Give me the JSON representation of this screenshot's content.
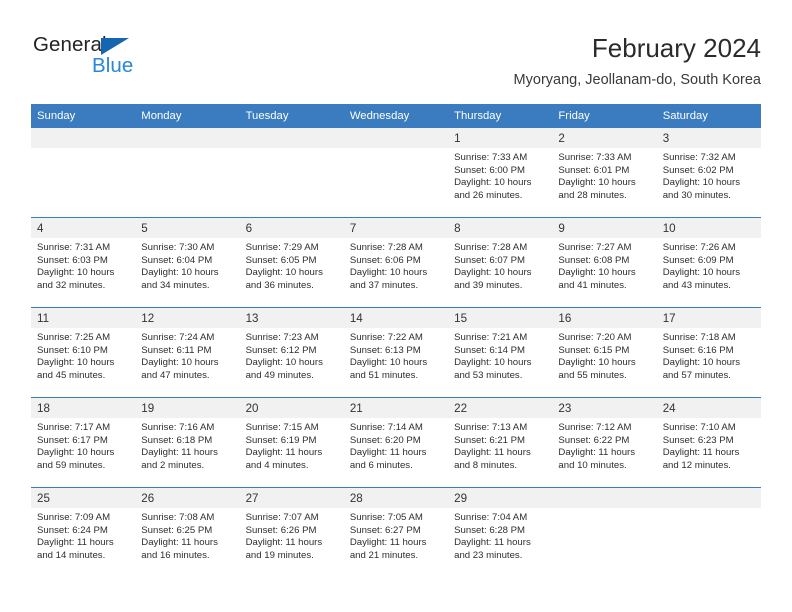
{
  "brand": {
    "line1": "General",
    "line2": "Blue",
    "triangle_color": "#1565b0",
    "line1_color": "#242424",
    "line2_color": "#2a86d8"
  },
  "header": {
    "title": "February 2024",
    "subtitle": "Myoryang, Jeollanam-do, South Korea"
  },
  "colors": {
    "header_row_bg": "#3a7cbf",
    "header_row_text": "#ffffff",
    "daynum_bg": "#f1f1f1",
    "cell_text": "#2e2e2e"
  },
  "weekdays": [
    "Sunday",
    "Monday",
    "Tuesday",
    "Wednesday",
    "Thursday",
    "Friday",
    "Saturday"
  ],
  "weeks": [
    [
      {
        "day": "",
        "sunrise": "",
        "sunset": "",
        "daylight_line1": "",
        "daylight_line2": ""
      },
      {
        "day": "",
        "sunrise": "",
        "sunset": "",
        "daylight_line1": "",
        "daylight_line2": ""
      },
      {
        "day": "",
        "sunrise": "",
        "sunset": "",
        "daylight_line1": "",
        "daylight_line2": ""
      },
      {
        "day": "",
        "sunrise": "",
        "sunset": "",
        "daylight_line1": "",
        "daylight_line2": ""
      },
      {
        "day": "1",
        "sunrise": "Sunrise: 7:33 AM",
        "sunset": "Sunset: 6:00 PM",
        "daylight_line1": "Daylight: 10 hours",
        "daylight_line2": "and 26 minutes."
      },
      {
        "day": "2",
        "sunrise": "Sunrise: 7:33 AM",
        "sunset": "Sunset: 6:01 PM",
        "daylight_line1": "Daylight: 10 hours",
        "daylight_line2": "and 28 minutes."
      },
      {
        "day": "3",
        "sunrise": "Sunrise: 7:32 AM",
        "sunset": "Sunset: 6:02 PM",
        "daylight_line1": "Daylight: 10 hours",
        "daylight_line2": "and 30 minutes."
      }
    ],
    [
      {
        "day": "4",
        "sunrise": "Sunrise: 7:31 AM",
        "sunset": "Sunset: 6:03 PM",
        "daylight_line1": "Daylight: 10 hours",
        "daylight_line2": "and 32 minutes."
      },
      {
        "day": "5",
        "sunrise": "Sunrise: 7:30 AM",
        "sunset": "Sunset: 6:04 PM",
        "daylight_line1": "Daylight: 10 hours",
        "daylight_line2": "and 34 minutes."
      },
      {
        "day": "6",
        "sunrise": "Sunrise: 7:29 AM",
        "sunset": "Sunset: 6:05 PM",
        "daylight_line1": "Daylight: 10 hours",
        "daylight_line2": "and 36 minutes."
      },
      {
        "day": "7",
        "sunrise": "Sunrise: 7:28 AM",
        "sunset": "Sunset: 6:06 PM",
        "daylight_line1": "Daylight: 10 hours",
        "daylight_line2": "and 37 minutes."
      },
      {
        "day": "8",
        "sunrise": "Sunrise: 7:28 AM",
        "sunset": "Sunset: 6:07 PM",
        "daylight_line1": "Daylight: 10 hours",
        "daylight_line2": "and 39 minutes."
      },
      {
        "day": "9",
        "sunrise": "Sunrise: 7:27 AM",
        "sunset": "Sunset: 6:08 PM",
        "daylight_line1": "Daylight: 10 hours",
        "daylight_line2": "and 41 minutes."
      },
      {
        "day": "10",
        "sunrise": "Sunrise: 7:26 AM",
        "sunset": "Sunset: 6:09 PM",
        "daylight_line1": "Daylight: 10 hours",
        "daylight_line2": "and 43 minutes."
      }
    ],
    [
      {
        "day": "11",
        "sunrise": "Sunrise: 7:25 AM",
        "sunset": "Sunset: 6:10 PM",
        "daylight_line1": "Daylight: 10 hours",
        "daylight_line2": "and 45 minutes."
      },
      {
        "day": "12",
        "sunrise": "Sunrise: 7:24 AM",
        "sunset": "Sunset: 6:11 PM",
        "daylight_line1": "Daylight: 10 hours",
        "daylight_line2": "and 47 minutes."
      },
      {
        "day": "13",
        "sunrise": "Sunrise: 7:23 AM",
        "sunset": "Sunset: 6:12 PM",
        "daylight_line1": "Daylight: 10 hours",
        "daylight_line2": "and 49 minutes."
      },
      {
        "day": "14",
        "sunrise": "Sunrise: 7:22 AM",
        "sunset": "Sunset: 6:13 PM",
        "daylight_line1": "Daylight: 10 hours",
        "daylight_line2": "and 51 minutes."
      },
      {
        "day": "15",
        "sunrise": "Sunrise: 7:21 AM",
        "sunset": "Sunset: 6:14 PM",
        "daylight_line1": "Daylight: 10 hours",
        "daylight_line2": "and 53 minutes."
      },
      {
        "day": "16",
        "sunrise": "Sunrise: 7:20 AM",
        "sunset": "Sunset: 6:15 PM",
        "daylight_line1": "Daylight: 10 hours",
        "daylight_line2": "and 55 minutes."
      },
      {
        "day": "17",
        "sunrise": "Sunrise: 7:18 AM",
        "sunset": "Sunset: 6:16 PM",
        "daylight_line1": "Daylight: 10 hours",
        "daylight_line2": "and 57 minutes."
      }
    ],
    [
      {
        "day": "18",
        "sunrise": "Sunrise: 7:17 AM",
        "sunset": "Sunset: 6:17 PM",
        "daylight_line1": "Daylight: 10 hours",
        "daylight_line2": "and 59 minutes."
      },
      {
        "day": "19",
        "sunrise": "Sunrise: 7:16 AM",
        "sunset": "Sunset: 6:18 PM",
        "daylight_line1": "Daylight: 11 hours",
        "daylight_line2": "and 2 minutes."
      },
      {
        "day": "20",
        "sunrise": "Sunrise: 7:15 AM",
        "sunset": "Sunset: 6:19 PM",
        "daylight_line1": "Daylight: 11 hours",
        "daylight_line2": "and 4 minutes."
      },
      {
        "day": "21",
        "sunrise": "Sunrise: 7:14 AM",
        "sunset": "Sunset: 6:20 PM",
        "daylight_line1": "Daylight: 11 hours",
        "daylight_line2": "and 6 minutes."
      },
      {
        "day": "22",
        "sunrise": "Sunrise: 7:13 AM",
        "sunset": "Sunset: 6:21 PM",
        "daylight_line1": "Daylight: 11 hours",
        "daylight_line2": "and 8 minutes."
      },
      {
        "day": "23",
        "sunrise": "Sunrise: 7:12 AM",
        "sunset": "Sunset: 6:22 PM",
        "daylight_line1": "Daylight: 11 hours",
        "daylight_line2": "and 10 minutes."
      },
      {
        "day": "24",
        "sunrise": "Sunrise: 7:10 AM",
        "sunset": "Sunset: 6:23 PM",
        "daylight_line1": "Daylight: 11 hours",
        "daylight_line2": "and 12 minutes."
      }
    ],
    [
      {
        "day": "25",
        "sunrise": "Sunrise: 7:09 AM",
        "sunset": "Sunset: 6:24 PM",
        "daylight_line1": "Daylight: 11 hours",
        "daylight_line2": "and 14 minutes."
      },
      {
        "day": "26",
        "sunrise": "Sunrise: 7:08 AM",
        "sunset": "Sunset: 6:25 PM",
        "daylight_line1": "Daylight: 11 hours",
        "daylight_line2": "and 16 minutes."
      },
      {
        "day": "27",
        "sunrise": "Sunrise: 7:07 AM",
        "sunset": "Sunset: 6:26 PM",
        "daylight_line1": "Daylight: 11 hours",
        "daylight_line2": "and 19 minutes."
      },
      {
        "day": "28",
        "sunrise": "Sunrise: 7:05 AM",
        "sunset": "Sunset: 6:27 PM",
        "daylight_line1": "Daylight: 11 hours",
        "daylight_line2": "and 21 minutes."
      },
      {
        "day": "29",
        "sunrise": "Sunrise: 7:04 AM",
        "sunset": "Sunset: 6:28 PM",
        "daylight_line1": "Daylight: 11 hours",
        "daylight_line2": "and 23 minutes."
      },
      {
        "day": "",
        "sunrise": "",
        "sunset": "",
        "daylight_line1": "",
        "daylight_line2": ""
      },
      {
        "day": "",
        "sunrise": "",
        "sunset": "",
        "daylight_line1": "",
        "daylight_line2": ""
      }
    ]
  ]
}
